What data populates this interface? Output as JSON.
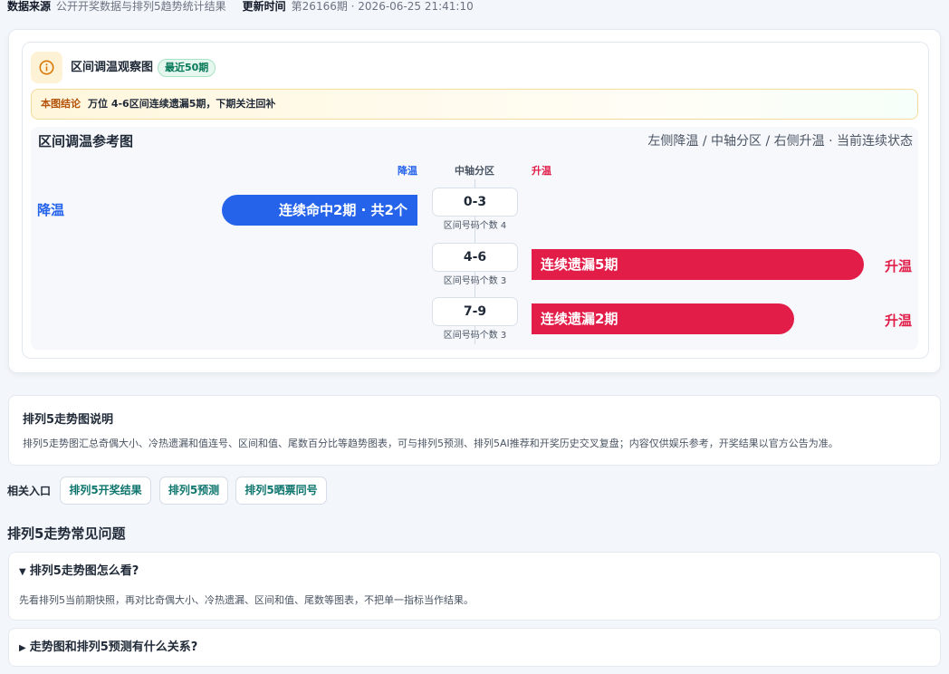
{
  "meta": {
    "source_label": "数据来源",
    "source_value": "公开开奖数据与排列5趋势统计结果",
    "update_label": "更新时间",
    "update_value": "第26166期 · 2026-06-25 21:41:10"
  },
  "card": {
    "title": "区间调温观察图",
    "badge": "最近50期",
    "conclusion_label": "本图结论",
    "conclusion_text": "万位 4-6区间连续遗漏5期，下期关注回补",
    "icon": "info-icon"
  },
  "chart_data": {
    "type": "bar",
    "title": "区间调温参考图",
    "subtitle": "左侧降温 / 中轴分区 / 右侧升温 · 当前连续状态",
    "column_headers": {
      "cool": "降温",
      "axis": "中轴分区",
      "warm": "升温"
    },
    "categories": [
      "0-3",
      "4-6",
      "7-9"
    ],
    "zone_counts": [
      "区间号码个数 4",
      "区间号码个数 3",
      "区间号码个数 3"
    ],
    "rows": [
      {
        "zone": "0-3",
        "direction": "cool",
        "streak": 2,
        "side_label": "降温",
        "bar_label": "连续命中2期 · 共2个"
      },
      {
        "zone": "4-6",
        "direction": "warm",
        "streak": 5,
        "side_label": "升温",
        "bar_label": "连续遗漏5期"
      },
      {
        "zone": "7-9",
        "direction": "warm",
        "streak": 2,
        "side_label": "升温",
        "bar_label": "连续遗漏2期"
      }
    ],
    "colors": {
      "cool": "#2563eb",
      "warm": "#e11d48"
    }
  },
  "description": {
    "title": "排列5走势图说明",
    "text": "排列5走势图汇总奇偶大小、冷热遗漏和值连号、区间和值、尾数百分比等趋势图表，可与排列5预测、排列5AI推荐和开奖历史交叉复盘；内容仅供娱乐参考，开奖结果以官方公告为准。"
  },
  "links": {
    "label": "相关入口",
    "items": [
      "排列5开奖结果",
      "排列5预测",
      "排列5晒票同号"
    ]
  },
  "faq": {
    "heading": "排列5走势常见问题",
    "items": [
      {
        "marker": "▼",
        "q": "排列5走势图怎么看?",
        "a": "先看排列5当前期快照，再对比奇偶大小、冷热遗漏、区间和值、尾数等图表，不把单一指标当作结果。"
      },
      {
        "marker": "▶",
        "q": "走势图和排列5预测有什么关系?"
      }
    ]
  }
}
